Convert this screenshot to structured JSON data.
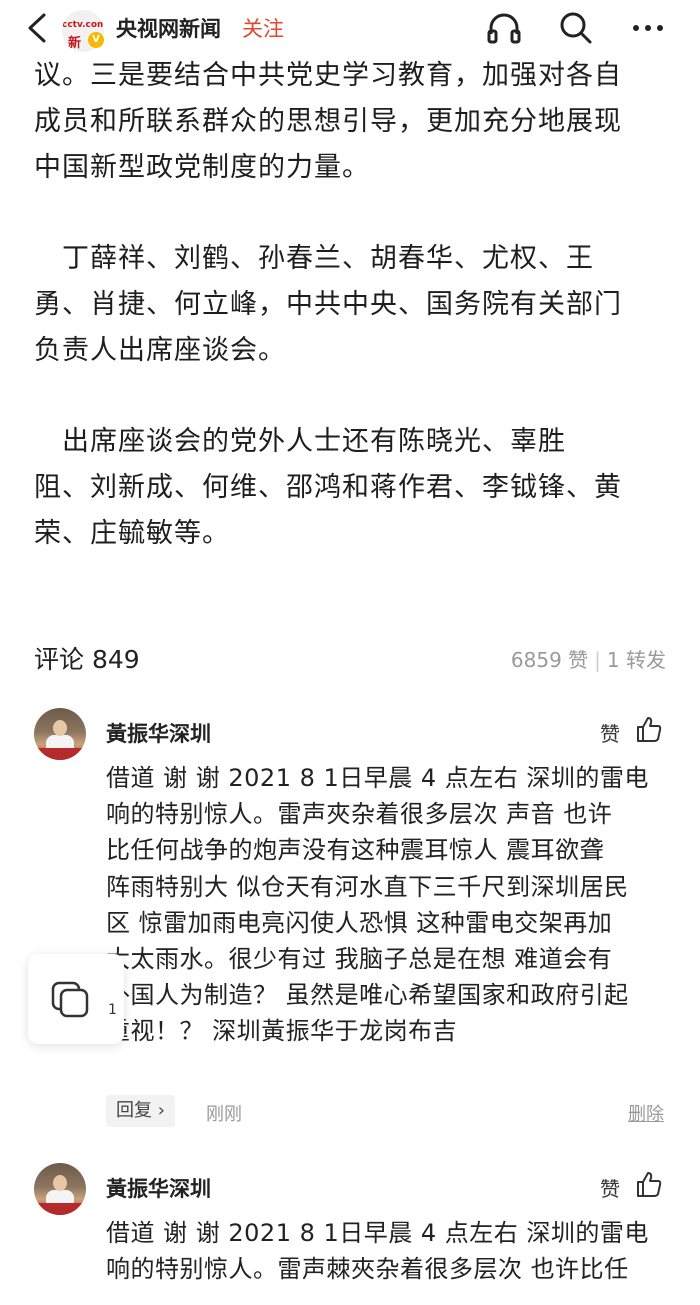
{
  "header": {
    "logo_top": "cctv.com",
    "logo_bottom": "新",
    "logo_badge": "V",
    "account_name": "央视网新闻",
    "follow_label": "关注",
    "icons": [
      "back-icon",
      "headphones-icon",
      "search-icon",
      "more-icon"
    ]
  },
  "article": {
    "paragraphs": [
      [
        "议。三是要结合中共党史学习教育，加强对各自",
        "成员和所联系群众的思想引导，更加充分地展现",
        "中国新型政党制度的力量。"
      ],
      [
        "　丁薛祥、刘鹤、孙春兰、胡春华、尤权、王",
        "勇、肖捷、何立峰，中共中央、国务院有关部门",
        "负责人出席座谈会。"
      ],
      [
        "　出席座谈会的党外人士还有陈晓光、辜胜",
        "阻、刘新成、何维、邵鸿和蒋作君、李钺锋、黄",
        "荣、庄毓敏等。"
      ]
    ]
  },
  "stats": {
    "comments_label": "评论 849",
    "likes": "6859 赞",
    "shares": "1 转发"
  },
  "comments": [
    {
      "author": "黃振华深圳",
      "like_label": "赞",
      "lines": [
        "借道 谢 谢 2021 8 1日早晨 4 点左右 深圳的雷电",
        "响的特别惊人。雷声夾杂着很多层次 声音 也许",
        "比任何战争的炮声没有这种震耳惊人 震耳欲聋",
        "阵雨特别大 似仓天有河水直下三千尺到深圳居民",
        "区 惊雷加雨电亮闪使人恐惧 这种雷电交架再加",
        "大太雨水。很少有过 我脑子总是在想 难道会有",
        "外国人为制造？ 虽然是唯心希望国家和政府引起",
        "重视！？ 深圳黃振华于龙岗布吉"
      ],
      "reply_label": "回复 ›",
      "time": "刚刚",
      "delete_label": "删除"
    },
    {
      "author": "黃振华深圳",
      "like_label": "赞",
      "lines": [
        "借道 谢 谢 2021 8 1日早晨 4 点左右 深圳的雷电",
        "响的特别惊人。雷声棘夾杂着很多层次 也许比任"
      ]
    }
  ],
  "float_card": {
    "count": "1"
  }
}
